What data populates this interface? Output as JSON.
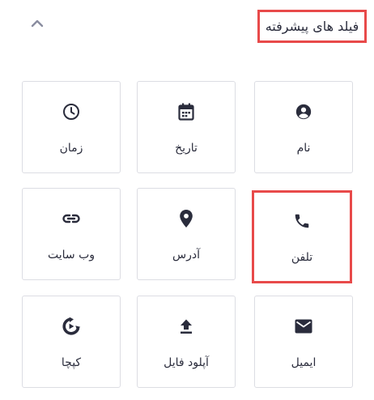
{
  "header": {
    "title": "فیلد های پیشرفته",
    "collapse_icon": "chevron-up-icon"
  },
  "fields": [
    {
      "label": "نام",
      "icon": "user-circle-icon"
    },
    {
      "label": "تاریخ",
      "icon": "calendar-icon"
    },
    {
      "label": "زمان",
      "icon": "clock-icon"
    },
    {
      "label": "تلفن",
      "icon": "phone-icon"
    },
    {
      "label": "آدرس",
      "icon": "map-pin-icon"
    },
    {
      "label": "وب سایت",
      "icon": "link-icon"
    },
    {
      "label": "ایمیل",
      "icon": "envelope-icon"
    },
    {
      "label": "آپلود فایل",
      "icon": "upload-icon"
    },
    {
      "label": "کپچا",
      "icon": "recaptcha-icon"
    }
  ],
  "colors": {
    "highlight": "#e84a4a",
    "text": "#2a2c3c",
    "border": "#dcdde3",
    "chevron": "#8a8da0"
  }
}
